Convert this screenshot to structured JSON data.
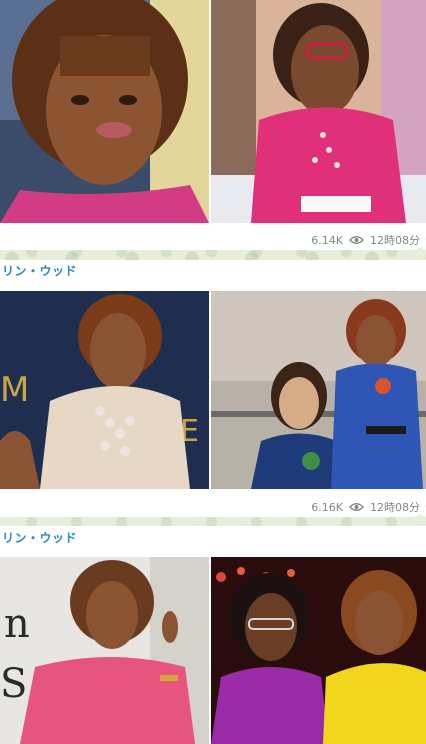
{
  "messages": [
    {
      "views": "6.14K",
      "time": "12時08分"
    },
    {
      "sender": "リン・ウッド",
      "views": "6.16K",
      "time": "12時08分"
    },
    {
      "sender": "リン・ウッド"
    }
  ],
  "icons": {
    "views": "eye-icon"
  },
  "colors": {
    "chat_bg": "#e7eedc",
    "sender_name": "#2a86c8",
    "meta_text": "#7f8a80"
  }
}
